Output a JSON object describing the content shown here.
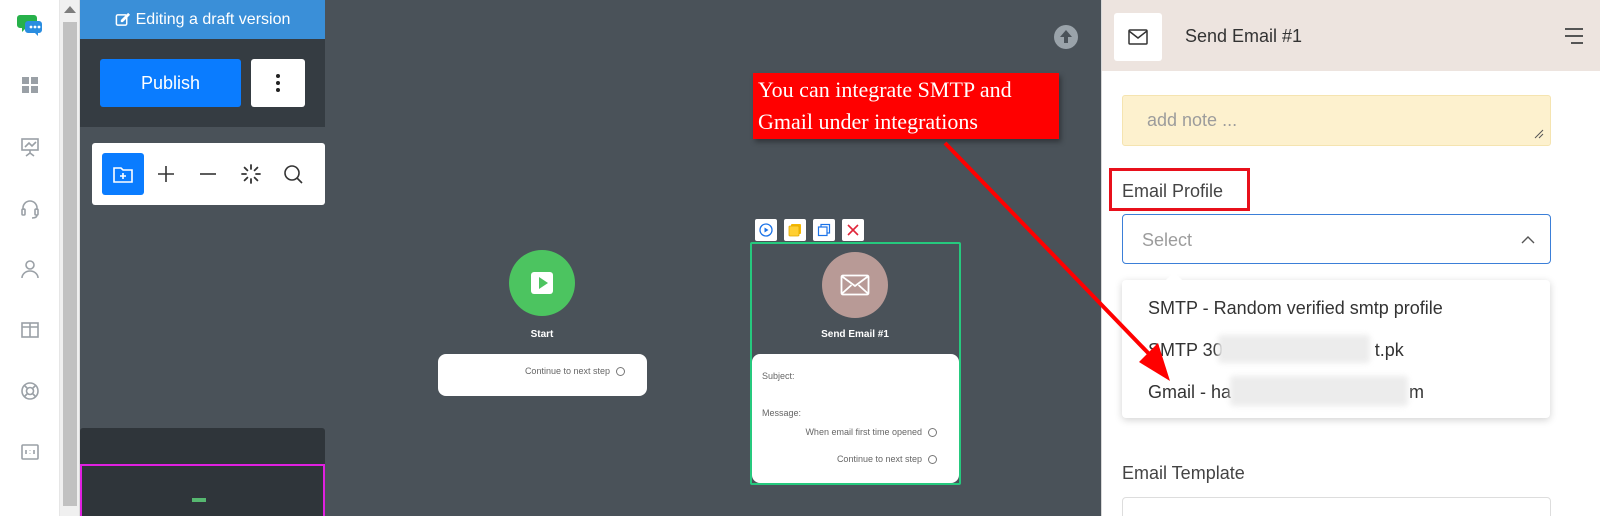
{
  "sidebar": {
    "items": [
      {
        "name": "dashboard"
      },
      {
        "name": "analytics"
      },
      {
        "name": "support"
      },
      {
        "name": "contacts"
      },
      {
        "name": "layout"
      },
      {
        "name": "help"
      },
      {
        "name": "forms"
      }
    ]
  },
  "canvas": {
    "draft_label": "Editing a draft version",
    "publish_label": "Publish",
    "toolbar": [
      "add-folder",
      "zoom-in",
      "zoom-out",
      "fit",
      "search"
    ]
  },
  "nodes": {
    "start": {
      "title": "Start",
      "rows": [
        "Continue to next step"
      ],
      "color": "#4cc460"
    },
    "email": {
      "title": "Send Email #1",
      "subject_label": "Subject:",
      "message_label": "Message:",
      "rows": [
        "When email first time opened",
        "Continue to next step"
      ],
      "color": "#b89a96",
      "border_color": "#26c97e"
    }
  },
  "annotation": {
    "text": "You can integrate SMTP and Gmail under integrations",
    "color": "#ff0000"
  },
  "panel": {
    "title": "Send Email #1",
    "note_placeholder": "add note ...",
    "email_profile_label": "Email Profile",
    "select_placeholder": "Select",
    "options": [
      {
        "prefix": "SMTP - Random verified smtp profile",
        "suffix": ""
      },
      {
        "prefix": "SMTP 30",
        "suffix": "t.pk"
      },
      {
        "prefix": "Gmail - ha",
        "suffix": "m"
      }
    ],
    "email_template_label": "Email Template"
  },
  "colors": {
    "accent": "#0a7cff",
    "draft_bar": "#3a8fd8",
    "canvas_bg": "#4a5259",
    "highlight": "#e8101b"
  }
}
